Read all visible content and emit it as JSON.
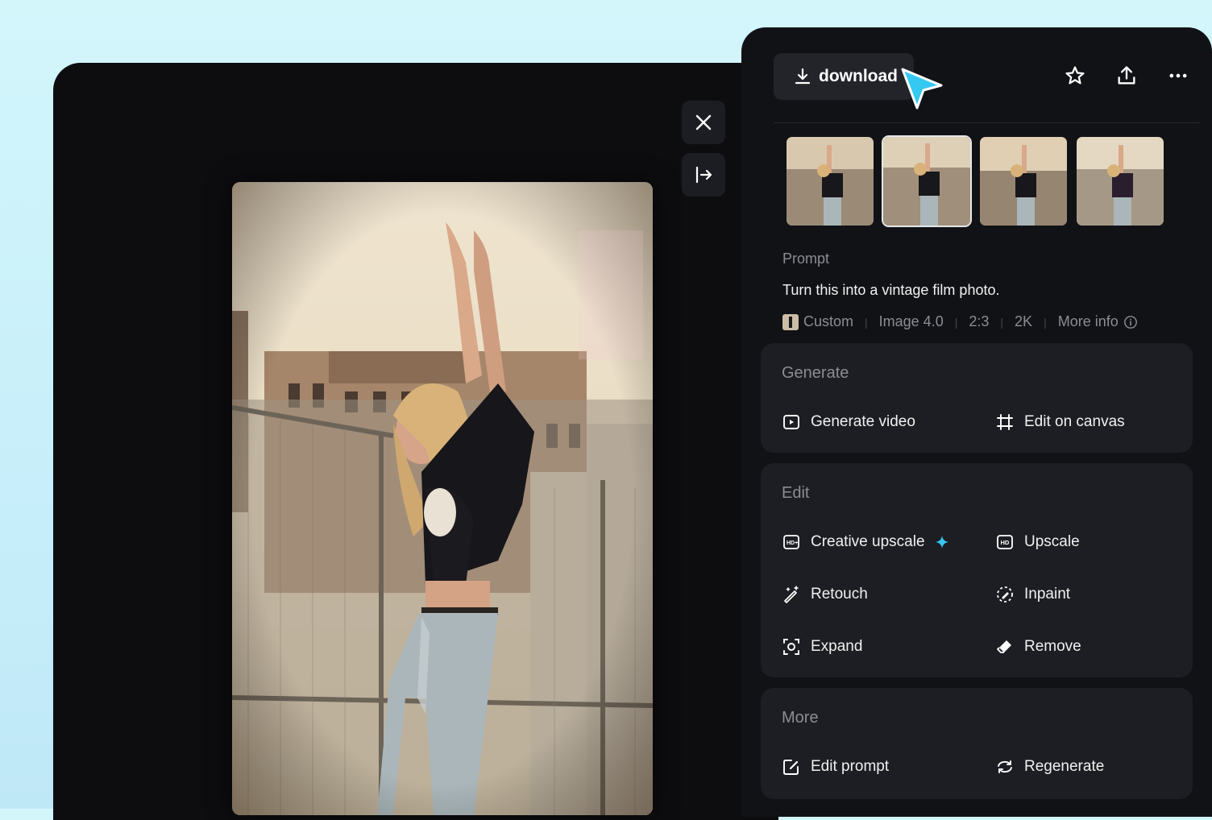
{
  "toolbar": {
    "download_label": "download",
    "icons": [
      "download-icon",
      "star-icon",
      "share-icon",
      "more-icon"
    ]
  },
  "viewer": {
    "icons": [
      "close-icon",
      "collapse-panel-icon"
    ]
  },
  "thumbnails": {
    "count": 4,
    "selected_index": 1
  },
  "prompt": {
    "label": "Prompt",
    "text": "Turn this into a vintage film photo."
  },
  "meta": {
    "model": "Custom",
    "version": "Image 4.0",
    "ratio": "2:3",
    "resolution": "2K",
    "more_info": "More info"
  },
  "generate": {
    "title": "Generate",
    "items": [
      {
        "label": "Generate video",
        "icon": "play-video-icon"
      },
      {
        "label": "Edit on canvas",
        "icon": "crop-canvas-icon"
      }
    ]
  },
  "edit": {
    "title": "Edit",
    "items": [
      {
        "label": "Creative upscale",
        "icon": "hd-plus-icon"
      },
      {
        "label": "Upscale",
        "icon": "hd-icon"
      },
      {
        "label": "Retouch",
        "icon": "magic-wand-icon"
      },
      {
        "label": "Inpaint",
        "icon": "inpaint-icon"
      },
      {
        "label": "Expand",
        "icon": "expand-icon"
      },
      {
        "label": "Remove",
        "icon": "eraser-icon"
      }
    ]
  },
  "more": {
    "title": "More",
    "items": [
      {
        "label": "Edit prompt",
        "icon": "edit-prompt-icon"
      },
      {
        "label": "Regenerate",
        "icon": "regenerate-icon"
      }
    ]
  },
  "colors": {
    "accent": "#35c9f2",
    "panel": "#111216",
    "section": "#1d1e23"
  }
}
